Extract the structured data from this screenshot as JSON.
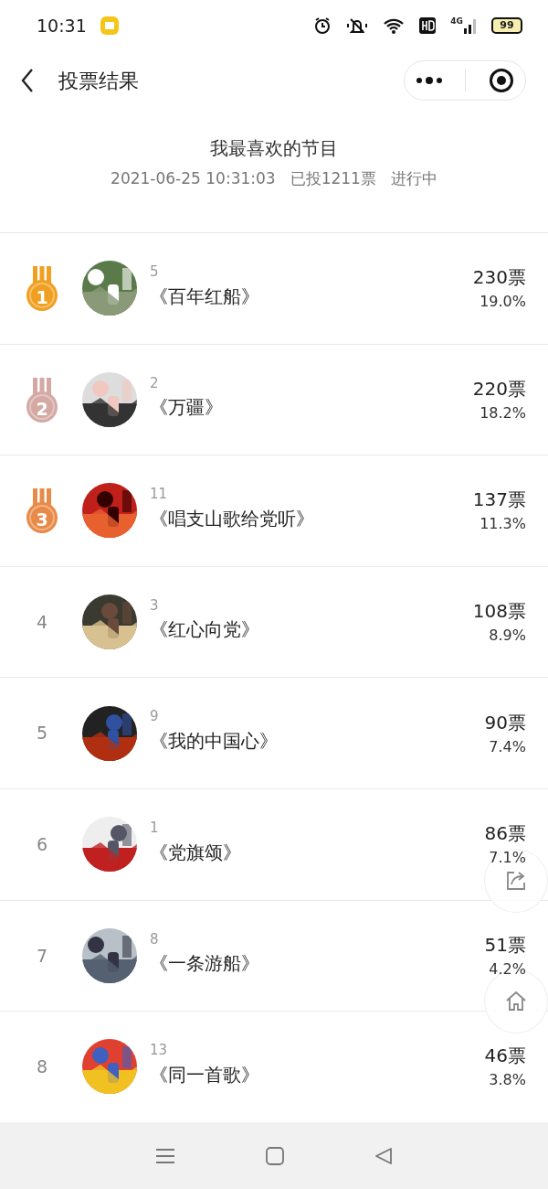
{
  "status_bar": {
    "time": "10:31",
    "battery": "99",
    "network": "4G"
  },
  "header": {
    "title": "投票结果"
  },
  "poll": {
    "title": "我最喜欢的节目",
    "date": "2021-06-25 10:31:03",
    "total": "已投1211票",
    "state": "进行中"
  },
  "results": [
    {
      "kind": "medal",
      "rank": "1",
      "color": "#f0a020",
      "number": "5",
      "name": "《百年红船》",
      "votes": "230票",
      "percent": "19.0%"
    },
    {
      "kind": "medal",
      "rank": "2",
      "color": "#d4a9a4",
      "number": "2",
      "name": "《万疆》",
      "votes": "220票",
      "percent": "18.2%"
    },
    {
      "kind": "medal",
      "rank": "3",
      "color": "#e88a48",
      "number": "11",
      "name": "《唱支山歌给党听》",
      "votes": "137票",
      "percent": "11.3%"
    },
    {
      "kind": "plain",
      "rank": "4",
      "number": "3",
      "name": "《红心向党》",
      "votes": "108票",
      "percent": "8.9%"
    },
    {
      "kind": "plain",
      "rank": "5",
      "number": "9",
      "name": "《我的中国心》",
      "votes": "90票",
      "percent": "7.4%"
    },
    {
      "kind": "plain",
      "rank": "6",
      "number": "1",
      "name": "《党旗颂》",
      "votes": "86票",
      "percent": "7.1%"
    },
    {
      "kind": "plain",
      "rank": "7",
      "number": "8",
      "name": "《一条游船》",
      "votes": "51票",
      "percent": "4.2%"
    },
    {
      "kind": "plain",
      "rank": "8",
      "number": "13",
      "name": "《同一首歌》",
      "votes": "46票",
      "percent": "3.8%"
    }
  ]
}
